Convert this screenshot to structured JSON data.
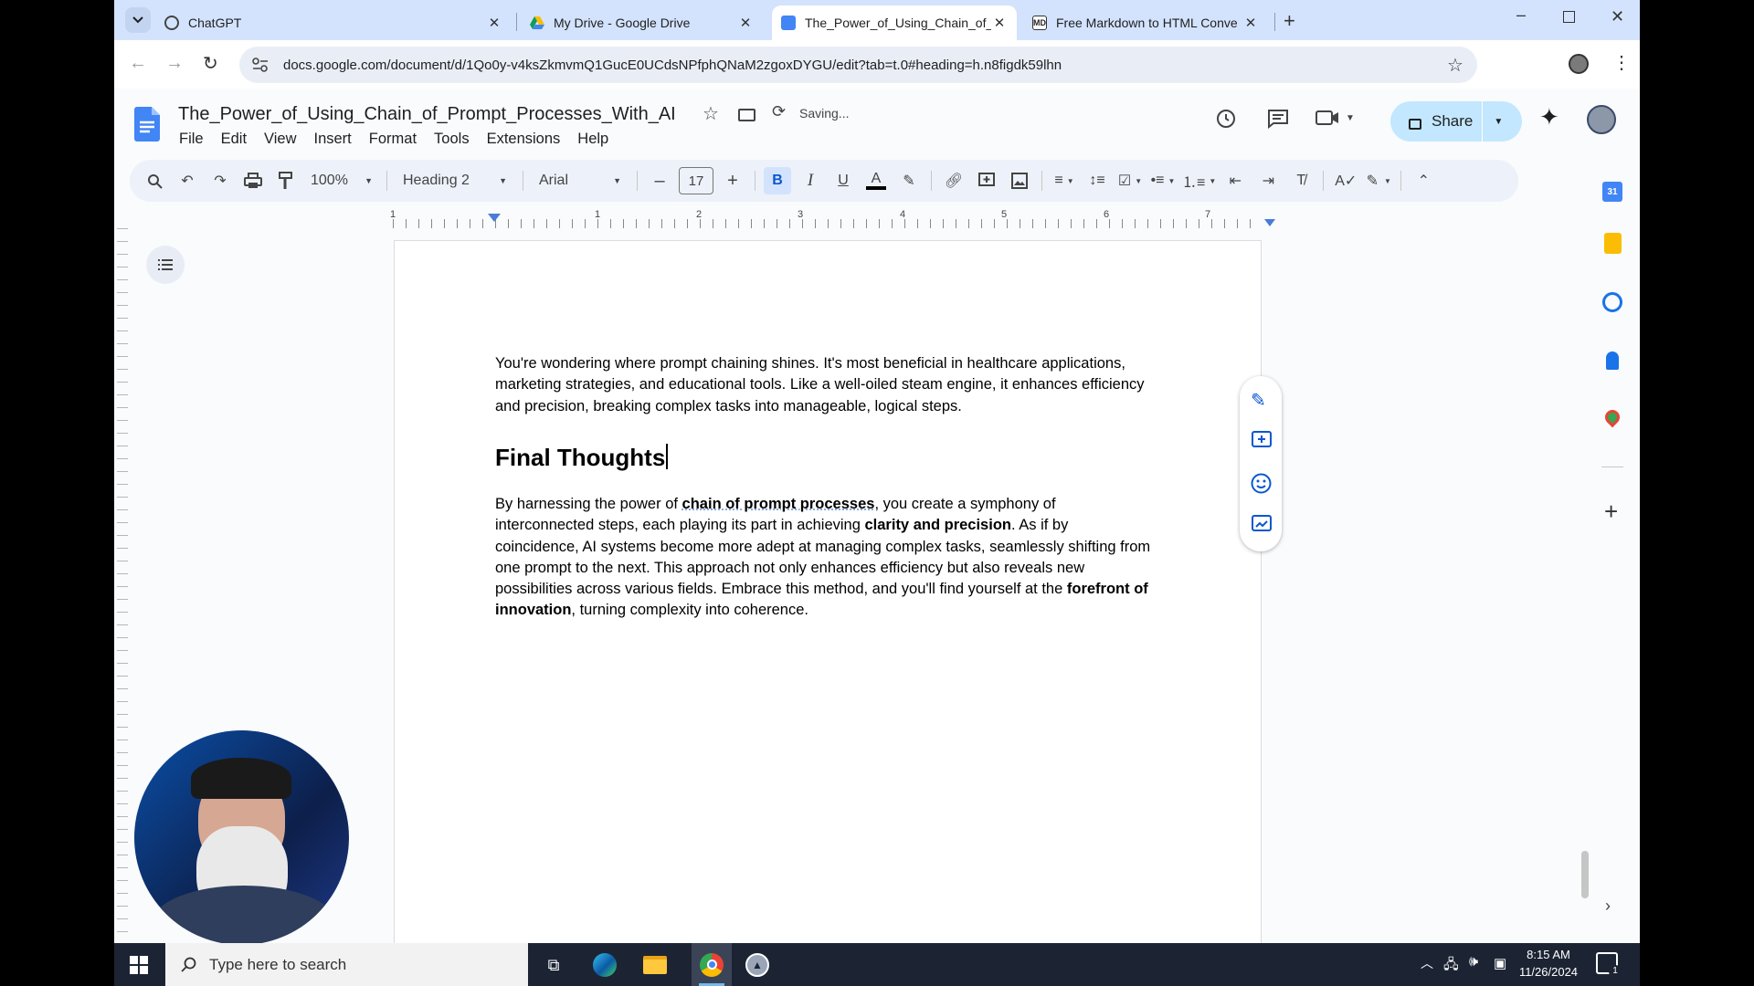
{
  "browser": {
    "tabs": [
      {
        "title": "ChatGPT",
        "active": false
      },
      {
        "title": "My Drive - Google Drive",
        "active": false
      },
      {
        "title": "The_Power_of_Using_Chain_of_",
        "active": true
      },
      {
        "title": "Free Markdown to HTML Conve",
        "active": false
      }
    ],
    "url": "docs.google.com/document/d/1Qo0y-v4ksZkmvmQ1GucE0UCdsNPfphQNaM2zgoxDYGU/edit?tab=t.0#heading=h.n8figdk59lhn"
  },
  "doc": {
    "title": "The_Power_of_Using_Chain_of_Prompt_Processes_With_AI",
    "status": "Saving...",
    "menus": [
      "File",
      "Edit",
      "View",
      "Insert",
      "Format",
      "Tools",
      "Extensions",
      "Help"
    ],
    "share_label": "Share"
  },
  "toolbar": {
    "zoom": "100%",
    "style": "Heading 2",
    "font": "Arial",
    "font_size": "17"
  },
  "ruler": {
    "ticks": [
      "1",
      "1",
      "2",
      "3",
      "4",
      "5",
      "6",
      "7"
    ]
  },
  "content": {
    "para1": "You're wondering where prompt chaining shines. It's most beneficial in healthcare applications, marketing strategies, and educational tools. Like a well-oiled steam engine, it enhances efficiency and precision, breaking complex tasks into manageable, logical steps.",
    "heading": "Final Thoughts",
    "para2_parts": {
      "p1": "By harnessing the power of ",
      "b1": "chain of prompt processes",
      "p2": ", you create a symphony of interconnected steps, each playing its part in achieving ",
      "b2": "clarity and precision",
      "p3": ". As if by coincidence, AI systems become more adept at managing complex tasks, seamlessly shifting from one prompt to the next. This approach not only enhances efficiency but also reveals new possibilities across various fields. Embrace this method, and you'll find yourself at the ",
      "b3": "forefront of innovation",
      "p4": ", turning complexity into coherence."
    }
  },
  "taskbar": {
    "search_placeholder": "Type here to search",
    "time": "8:15 AM",
    "date": "11/26/2024",
    "notification_count": "1"
  },
  "colors": {
    "tab_strip": "#d3e3fd",
    "share_bg": "#c2e7ff",
    "docs_blue": "#4285f4"
  }
}
